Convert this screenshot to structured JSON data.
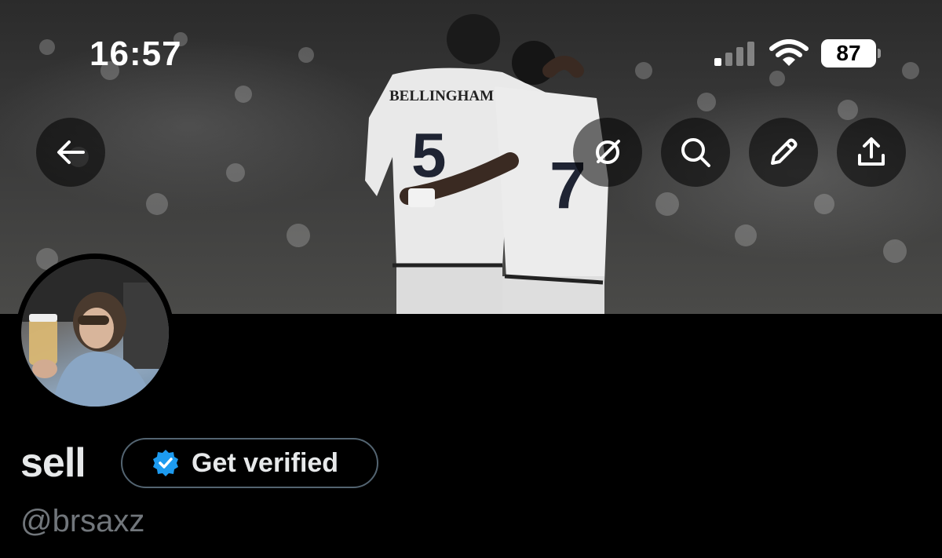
{
  "status_bar": {
    "time": "16:57",
    "battery": "87"
  },
  "header_actions": {
    "back_icon": "arrow-left-icon",
    "grok_icon": "grok-icon",
    "search_icon": "search-icon",
    "edit_icon": "pencil-icon",
    "share_icon": "share-icon"
  },
  "banner": {
    "jersey_name": "BELLINGHAM",
    "jersey_number_left": "5",
    "jersey_number_right": "7"
  },
  "profile": {
    "display_name": "sell",
    "verify_label": "Get verified",
    "handle": "@brsaxz"
  },
  "colors": {
    "background": "#000000",
    "verify_badge": "#1d9bf0",
    "text_primary": "#e7e9ea",
    "text_secondary": "#71767b"
  }
}
